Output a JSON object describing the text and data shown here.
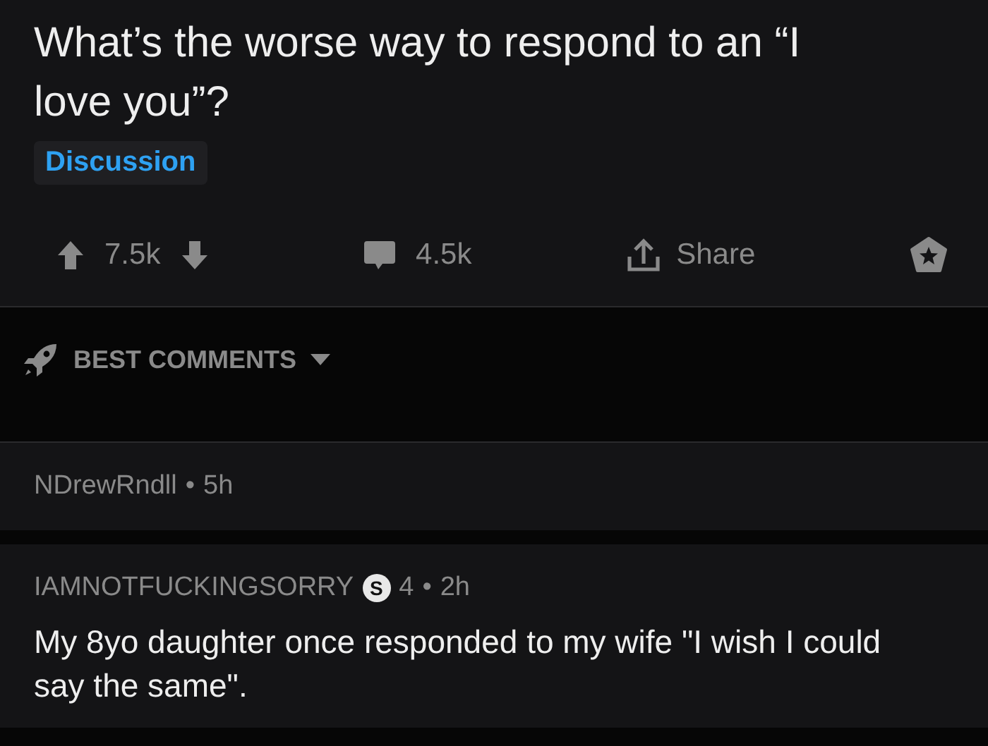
{
  "post": {
    "title": "What’s the worse way to respond to an “I love you”?",
    "flair": "Discussion",
    "score": "7.5k",
    "comments": "4.5k",
    "share": "Share"
  },
  "sort": {
    "label": "BEST COMMENTS"
  },
  "comments": [
    {
      "author": "NDrewRndll",
      "separator": "•",
      "time": "5h"
    },
    {
      "author": "IAMNOTFUCKINGSORRY",
      "badge": "S",
      "score": "4",
      "separator": "•",
      "time": "2h",
      "body": "My 8yo daughter once responded to my wife \"I wish I could say the same\"."
    }
  ]
}
